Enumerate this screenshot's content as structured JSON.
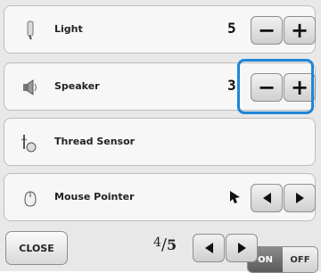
{
  "settings": {
    "rows": [
      {
        "label": "Light",
        "level": "5",
        "icon": "bulb-icon"
      },
      {
        "label": "Speaker",
        "level": "3",
        "icon": "speaker-icon"
      },
      {
        "label": "Thread Sensor",
        "icon": "thread-sensor-icon",
        "toggle": {
          "on": "ON",
          "off": "OFF",
          "state": "ON"
        }
      },
      {
        "label": "Mouse Pointer",
        "icon": "mouse-icon"
      }
    ],
    "controls": {
      "minus": "−",
      "plus": "+"
    }
  },
  "footer": {
    "close_label": "CLOSE",
    "page_current": "4",
    "page_total": "5"
  },
  "colors": {
    "panel_bg": "#e8e8e8",
    "row_bg": "#f7f7f7",
    "highlight": "#1e86d8"
  }
}
